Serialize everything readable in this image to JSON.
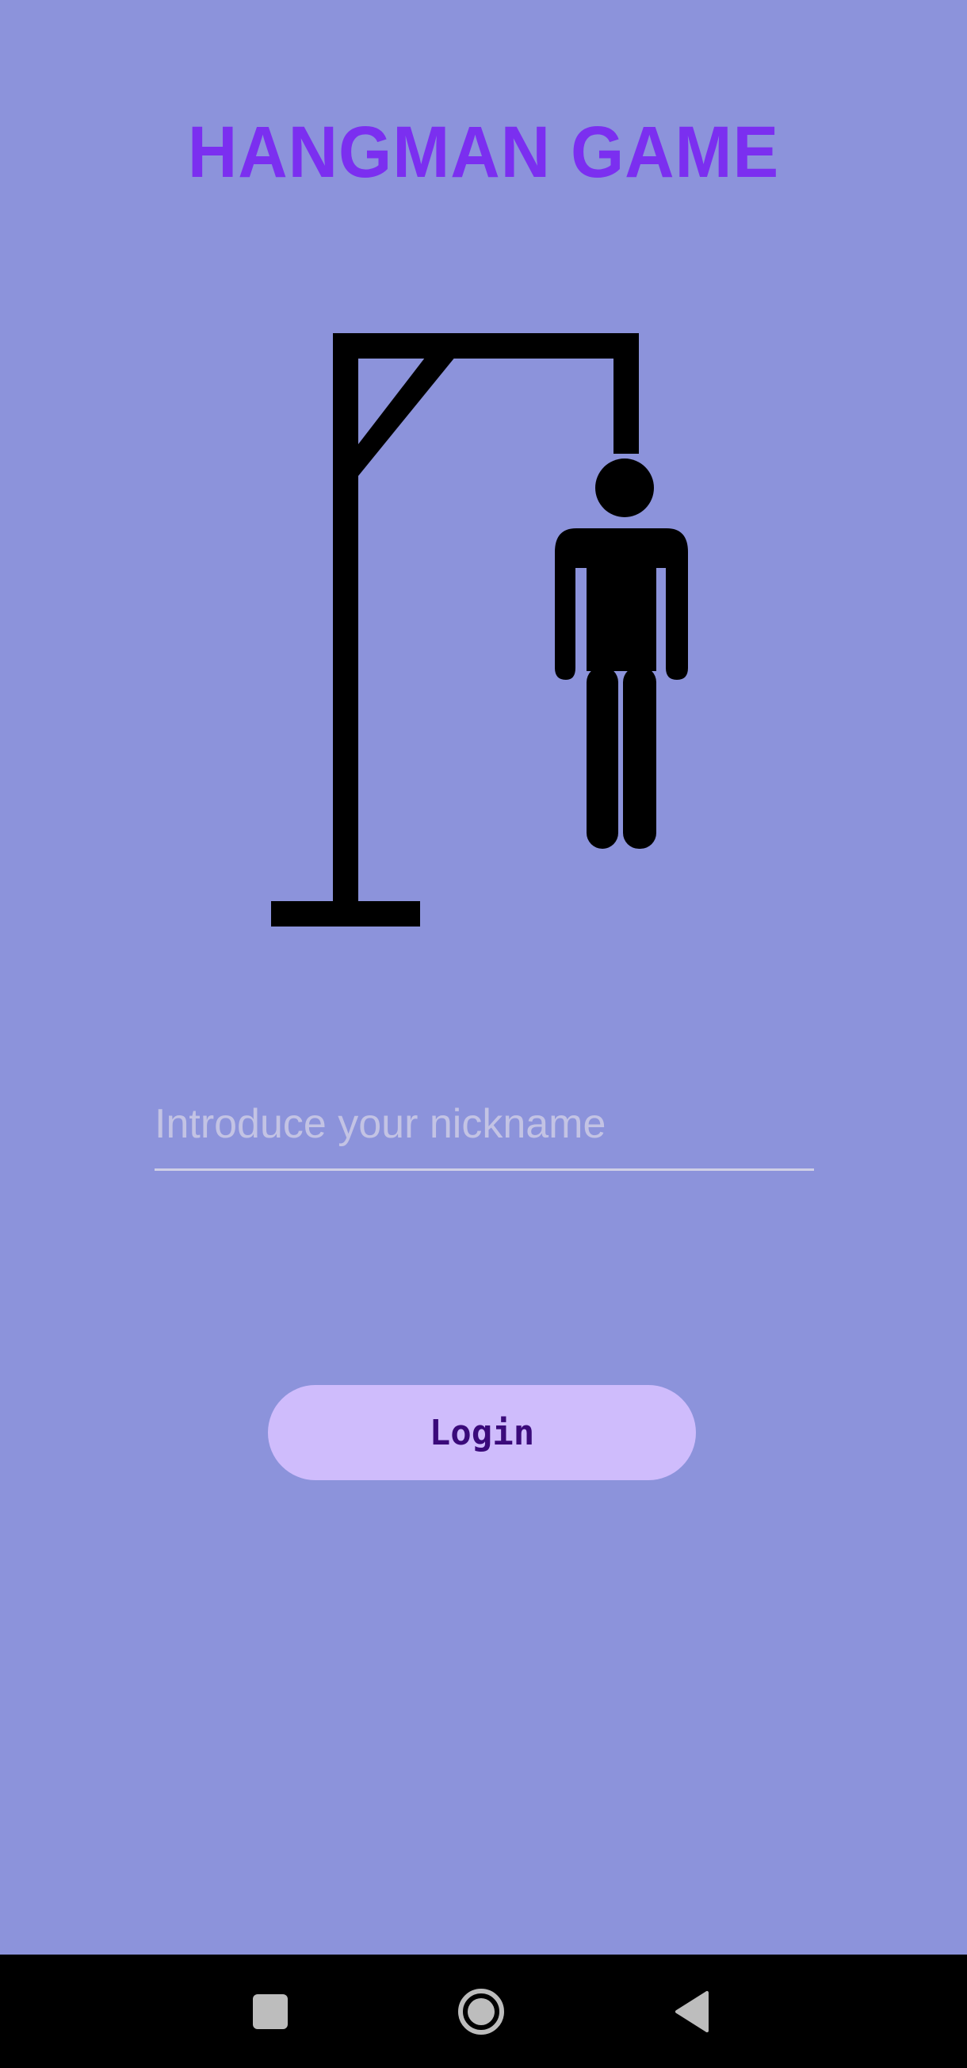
{
  "app": {
    "title": "HANGMAN GAME"
  },
  "login_form": {
    "nickname_placeholder": "Introduce your nickname",
    "nickname_value": "",
    "login_label": "Login"
  },
  "navigation_bar": {
    "buttons": [
      "recents-square-icon",
      "home-circle-icon",
      "back-triangle-icon"
    ]
  },
  "colors": {
    "background": "#8c93db",
    "title": "#7b2ff0",
    "illustration": "#000000",
    "input_underline": "#cfcfe6",
    "placeholder": "#c3c3e4",
    "button_background": "#cfbcfc",
    "button_text": "#3a0a7a",
    "nav_bar": "#000000",
    "nav_icons": "#bdbdbd"
  }
}
